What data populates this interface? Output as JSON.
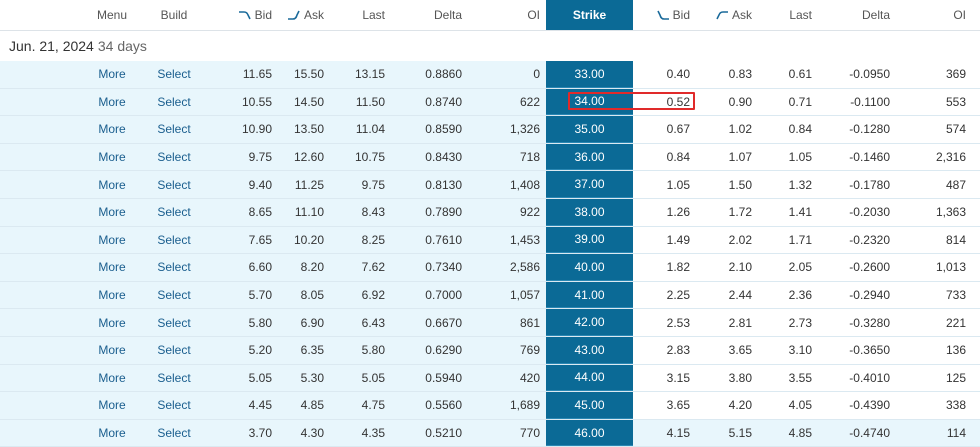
{
  "header": {
    "call_cols": [
      "Menu",
      "Build",
      "Bid",
      "Ask",
      "Last",
      "Delta",
      "OI"
    ],
    "strike": "Strike",
    "put_cols": [
      "Bid",
      "Ask",
      "Last",
      "Delta",
      "OI"
    ]
  },
  "expiry": {
    "date": "Jun. 21, 2024",
    "days": "34 days"
  },
  "rows": [
    {
      "menu": "More",
      "build": "Select",
      "c_bid": "11.65",
      "c_ask": "15.50",
      "c_last": "13.15",
      "c_delta": "0.8860",
      "c_oi": "0",
      "strike": "33.00",
      "p_bid": "0.40",
      "p_ask": "0.83",
      "p_last": "0.61",
      "p_delta": "-0.0950",
      "p_oi": "369"
    },
    {
      "menu": "More",
      "build": "Select",
      "c_bid": "10.55",
      "c_ask": "14.50",
      "c_last": "11.50",
      "c_delta": "0.8740",
      "c_oi": "622",
      "strike": "34.00",
      "p_bid": "0.52",
      "p_ask": "0.90",
      "p_last": "0.71",
      "p_delta": "-0.1100",
      "p_oi": "553"
    },
    {
      "menu": "More",
      "build": "Select",
      "c_bid": "10.90",
      "c_ask": "13.50",
      "c_last": "11.04",
      "c_delta": "0.8590",
      "c_oi": "1,326",
      "strike": "35.00",
      "p_bid": "0.67",
      "p_ask": "1.02",
      "p_last": "0.84",
      "p_delta": "-0.1280",
      "p_oi": "574"
    },
    {
      "menu": "More",
      "build": "Select",
      "c_bid": "9.75",
      "c_ask": "12.60",
      "c_last": "10.75",
      "c_delta": "0.8430",
      "c_oi": "718",
      "strike": "36.00",
      "p_bid": "0.84",
      "p_ask": "1.07",
      "p_last": "1.05",
      "p_delta": "-0.1460",
      "p_oi": "2,316"
    },
    {
      "menu": "More",
      "build": "Select",
      "c_bid": "9.40",
      "c_ask": "11.25",
      "c_last": "9.75",
      "c_delta": "0.8130",
      "c_oi": "1,408",
      "strike": "37.00",
      "p_bid": "1.05",
      "p_ask": "1.50",
      "p_last": "1.32",
      "p_delta": "-0.1780",
      "p_oi": "487"
    },
    {
      "menu": "More",
      "build": "Select",
      "c_bid": "8.65",
      "c_ask": "11.10",
      "c_last": "8.43",
      "c_delta": "0.7890",
      "c_oi": "922",
      "strike": "38.00",
      "p_bid": "1.26",
      "p_ask": "1.72",
      "p_last": "1.41",
      "p_delta": "-0.2030",
      "p_oi": "1,363"
    },
    {
      "menu": "More",
      "build": "Select",
      "c_bid": "7.65",
      "c_ask": "10.20",
      "c_last": "8.25",
      "c_delta": "0.7610",
      "c_oi": "1,453",
      "strike": "39.00",
      "p_bid": "1.49",
      "p_ask": "2.02",
      "p_last": "1.71",
      "p_delta": "-0.2320",
      "p_oi": "814"
    },
    {
      "menu": "More",
      "build": "Select",
      "c_bid": "6.60",
      "c_ask": "8.20",
      "c_last": "7.62",
      "c_delta": "0.7340",
      "c_oi": "2,586",
      "strike": "40.00",
      "p_bid": "1.82",
      "p_ask": "2.10",
      "p_last": "2.05",
      "p_delta": "-0.2600",
      "p_oi": "1,013"
    },
    {
      "menu": "More",
      "build": "Select",
      "c_bid": "5.70",
      "c_ask": "8.05",
      "c_last": "6.92",
      "c_delta": "0.7000",
      "c_oi": "1,057",
      "strike": "41.00",
      "p_bid": "2.25",
      "p_ask": "2.44",
      "p_last": "2.36",
      "p_delta": "-0.2940",
      "p_oi": "733"
    },
    {
      "menu": "More",
      "build": "Select",
      "c_bid": "5.80",
      "c_ask": "6.90",
      "c_last": "6.43",
      "c_delta": "0.6670",
      "c_oi": "861",
      "strike": "42.00",
      "p_bid": "2.53",
      "p_ask": "2.81",
      "p_last": "2.73",
      "p_delta": "-0.3280",
      "p_oi": "221"
    },
    {
      "menu": "More",
      "build": "Select",
      "c_bid": "5.20",
      "c_ask": "6.35",
      "c_last": "5.80",
      "c_delta": "0.6290",
      "c_oi": "769",
      "strike": "43.00",
      "p_bid": "2.83",
      "p_ask": "3.65",
      "p_last": "3.10",
      "p_delta": "-0.3650",
      "p_oi": "136"
    },
    {
      "menu": "More",
      "build": "Select",
      "c_bid": "5.05",
      "c_ask": "5.30",
      "c_last": "5.05",
      "c_delta": "0.5940",
      "c_oi": "420",
      "strike": "44.00",
      "p_bid": "3.15",
      "p_ask": "3.80",
      "p_last": "3.55",
      "p_delta": "-0.4010",
      "p_oi": "125"
    },
    {
      "menu": "More",
      "build": "Select",
      "c_bid": "4.45",
      "c_ask": "4.85",
      "c_last": "4.75",
      "c_delta": "0.5560",
      "c_oi": "1,689",
      "strike": "45.00",
      "p_bid": "3.65",
      "p_ask": "4.20",
      "p_last": "4.05",
      "p_delta": "-0.4390",
      "p_oi": "338"
    },
    {
      "menu": "More",
      "build": "Select",
      "c_bid": "3.70",
      "c_ask": "4.30",
      "c_last": "4.35",
      "c_delta": "0.5210",
      "c_oi": "770",
      "strike": "46.00",
      "p_bid": "4.15",
      "p_ask": "5.15",
      "p_last": "4.85",
      "p_delta": "-0.4740",
      "p_oi": "114",
      "put_itm": true
    }
  ],
  "colors": {
    "strike_bg": "#0b6a96",
    "itm_bg": "#e8f6fc",
    "link": "#1a5e8e",
    "highlight": "#e02a2a"
  }
}
